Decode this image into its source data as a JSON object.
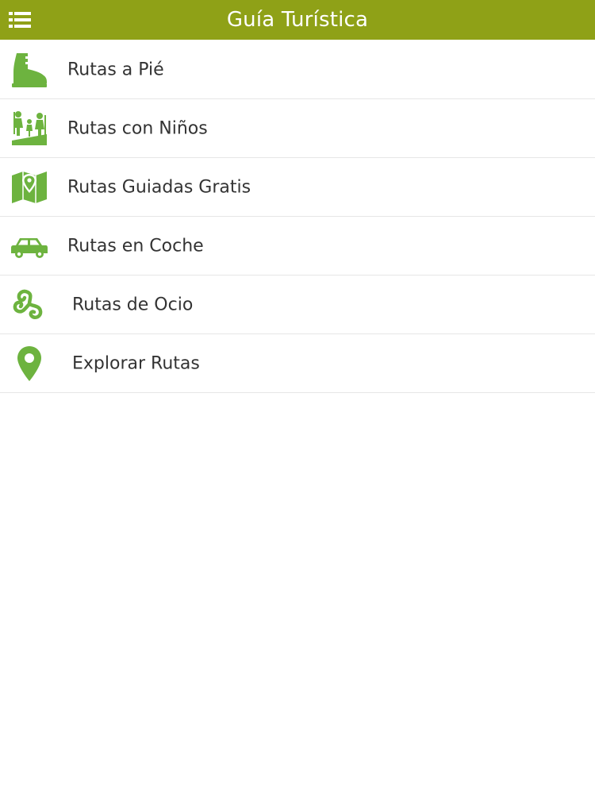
{
  "header": {
    "title": "Guía Turística",
    "menu_icon": "hamburger-menu-icon",
    "background_color": "#8fa117"
  },
  "accent_color": "#6db33f",
  "menu": {
    "items": [
      {
        "label": "Rutas a Pié",
        "icon": "hiking-boot-icon"
      },
      {
        "label": "Rutas con Niños",
        "icon": "family-hiking-icon"
      },
      {
        "label": "Rutas Guiadas Gratis",
        "icon": "map-pin-map-icon"
      },
      {
        "label": "Rutas en Coche",
        "icon": "car-icon"
      },
      {
        "label": "Rutas de Ocio",
        "icon": "triskele-icon"
      },
      {
        "label": "Explorar Rutas",
        "icon": "location-pin-icon"
      }
    ]
  }
}
